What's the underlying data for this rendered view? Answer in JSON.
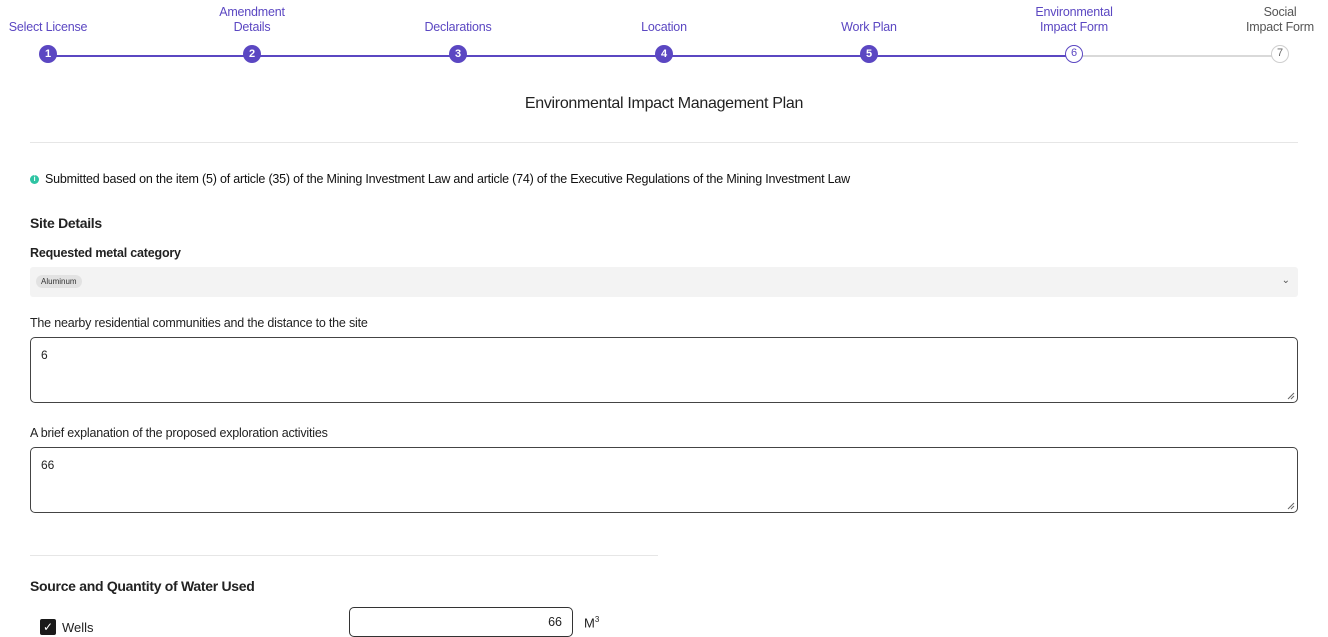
{
  "stepper": {
    "steps": [
      {
        "number": "1",
        "label": "Select License",
        "state": "done"
      },
      {
        "number": "2",
        "label": "Amendment Details",
        "state": "done"
      },
      {
        "number": "3",
        "label": "Declarations",
        "state": "done"
      },
      {
        "number": "4",
        "label": "Location",
        "state": "done"
      },
      {
        "number": "5",
        "label": "Work Plan",
        "state": "done"
      },
      {
        "number": "6",
        "label": "Environmental Impact Form",
        "state": "active"
      },
      {
        "number": "7",
        "label": "Social Impact Form",
        "state": "todo"
      }
    ],
    "accent_color": "#5b47c2"
  },
  "page_title": "Environmental Impact Management Plan",
  "info_note": "Submitted based on the item (5) of article (35) of the Mining Investment Law and article (74) of the Executive Regulations of the Mining Investment Law",
  "site_details": {
    "title": "Site Details",
    "metal_category": {
      "label": "Requested metal category",
      "selected": "Aluminum"
    },
    "residential": {
      "label": "The nearby residential communities and the distance to the site",
      "value": "6"
    },
    "exploration": {
      "label": "A brief explanation of the proposed exploration activities",
      "value": "66"
    }
  },
  "water": {
    "title": "Source and Quantity of Water Used",
    "wells": {
      "label": "Wells",
      "checked": true,
      "quantity": "66",
      "unit": "M",
      "unit_sup": "3"
    }
  },
  "icons": {
    "info": "info-icon",
    "chevron": "chevron-down-icon",
    "check": "check-icon",
    "resize": "resize-handle-icon"
  }
}
